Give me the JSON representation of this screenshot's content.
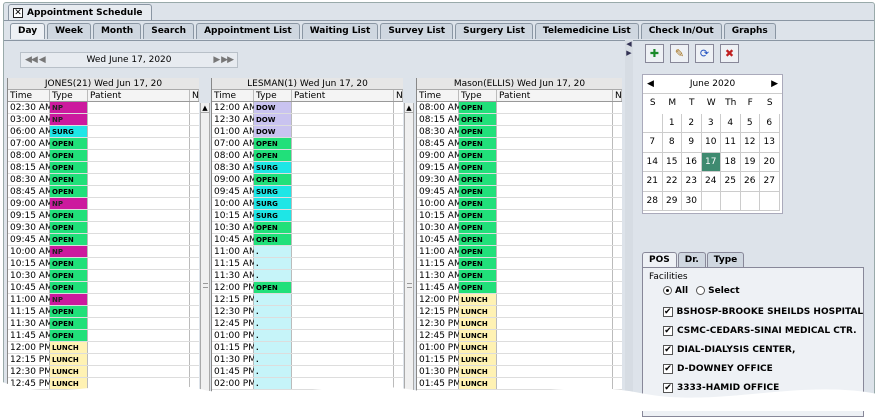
{
  "window": {
    "title": "Appointment Schedule"
  },
  "tabs": [
    "Day",
    "Week",
    "Month",
    "Search",
    "Appointment List",
    "Waiting List",
    "Survey List",
    "Surgery List",
    "Telemedicine List",
    "Check In/Out",
    "Graphs"
  ],
  "active_tab": "Day",
  "datebar": {
    "prev": "◀◀ ◀",
    "date": "Wed   June 17, 2020",
    "next": "▶ ▶▶"
  },
  "table_headers": {
    "time": "Time",
    "type": "Type",
    "patient": "Patient",
    "note": "N"
  },
  "columns": [
    {
      "header": "JONES(21) Wed Jun 17, 20",
      "rows": [
        [
          "02:30 AM",
          "NP"
        ],
        [
          "03:00 AM",
          "NP"
        ],
        [
          "06:00 AM",
          "SURG"
        ],
        [
          "07:00 AM",
          "OPEN"
        ],
        [
          "08:00 AM",
          "OPEN"
        ],
        [
          "08:15 AM",
          "OPEN"
        ],
        [
          "08:30 AM",
          "OPEN"
        ],
        [
          "08:45 AM",
          "OPEN"
        ],
        [
          "09:00 AM",
          "NP"
        ],
        [
          "09:15 AM",
          "OPEN"
        ],
        [
          "09:30 AM",
          "OPEN"
        ],
        [
          "09:45 AM",
          "OPEN"
        ],
        [
          "10:00 AM",
          "NP"
        ],
        [
          "10:15 AM",
          "OPEN"
        ],
        [
          "10:30 AM",
          "OPEN"
        ],
        [
          "10:45 AM",
          "OPEN"
        ],
        [
          "11:00 AM",
          "NP"
        ],
        [
          "11:15 AM",
          "OPEN"
        ],
        [
          "11:30 AM",
          "OPEN"
        ],
        [
          "11:45 AM",
          "OPEN"
        ],
        [
          "12:00 PM",
          "LUNCH"
        ],
        [
          "12:15 PM",
          "LUNCH"
        ],
        [
          "12:30 PM",
          "LUNCH"
        ],
        [
          "12:45 PM",
          "LUNCH"
        ]
      ]
    },
    {
      "header": "LESMAN(1) Wed Jun 17, 20",
      "rows": [
        [
          "12:00 AM",
          "DOW"
        ],
        [
          "12:30 AM",
          "DOW"
        ],
        [
          "01:00 AM",
          "DOW"
        ],
        [
          "07:00 AM",
          "OPEN"
        ],
        [
          "08:00 AM",
          "OPEN"
        ],
        [
          "08:30 AM",
          "SURG"
        ],
        [
          "09:00 AM",
          "OPEN"
        ],
        [
          "09:45 AM",
          "SURG"
        ],
        [
          "10:00 AM",
          "SURG"
        ],
        [
          "10:15 AM",
          "SURG"
        ],
        [
          "10:30 AM",
          "OPEN"
        ],
        [
          "10:45 AM",
          "OPEN"
        ],
        [
          "11:00 AM",
          "."
        ],
        [
          "11:15 AM",
          "."
        ],
        [
          "11:30 AM",
          "."
        ],
        [
          "12:00 PM",
          "OPEN"
        ],
        [
          "12:15 PM",
          "."
        ],
        [
          "12:30 PM",
          "."
        ],
        [
          "12:45 PM",
          "."
        ],
        [
          "01:00 PM",
          "."
        ],
        [
          "01:15 PM",
          "."
        ],
        [
          "01:30 PM",
          "."
        ],
        [
          "01:45 PM",
          "."
        ],
        [
          "02:00 PM",
          "."
        ]
      ]
    },
    {
      "header": "Mason(ELLIS) Wed Jun 17, 20",
      "rows": [
        [
          "08:00 AM",
          "OPEN"
        ],
        [
          "08:15 AM",
          "OPEN"
        ],
        [
          "08:30 AM",
          "OPEN"
        ],
        [
          "08:45 AM",
          "OPEN"
        ],
        [
          "09:00 AM",
          "OPEN"
        ],
        [
          "09:15 AM",
          "OPEN"
        ],
        [
          "09:30 AM",
          "OPEN"
        ],
        [
          "09:45 AM",
          "OPEN"
        ],
        [
          "10:00 AM",
          "OPEN"
        ],
        [
          "10:15 AM",
          "OPEN"
        ],
        [
          "10:30 AM",
          "OPEN"
        ],
        [
          "10:45 AM",
          "OPEN"
        ],
        [
          "11:00 AM",
          "OPEN"
        ],
        [
          "11:15 AM",
          "OPEN"
        ],
        [
          "11:30 AM",
          "OPEN"
        ],
        [
          "11:45 AM",
          "OPEN"
        ],
        [
          "12:00 PM",
          "LUNCH"
        ],
        [
          "12:15 PM",
          "LUNCH"
        ],
        [
          "12:30 PM",
          "LUNCH"
        ],
        [
          "12:45 PM",
          "LUNCH"
        ],
        [
          "01:00 PM",
          "LUNCH"
        ],
        [
          "01:15 PM",
          "LUNCH"
        ],
        [
          "01:30 PM",
          "LUNCH"
        ],
        [
          "01:45 PM",
          "LUNCH"
        ]
      ]
    }
  ],
  "type_colors": {
    "NP": "#cc1a9e",
    "SURG": "#1ee6e6",
    "OPEN": "#21e07a",
    "LUNCH": "#fff2b3",
    "DOW": "#c9c3f0",
    ".": "#c6f4f9"
  },
  "toolbar_icons": [
    "add-appointment-icon",
    "edit-appointment-icon",
    "refresh-icon",
    "delete-appointment-icon"
  ],
  "calendar": {
    "month_label": "June  2020",
    "weekdays": [
      "S",
      "M",
      "T",
      "W",
      "Th",
      "F",
      "S"
    ],
    "weeks": [
      [
        "",
        "1",
        "2",
        "3",
        "4",
        "5",
        "6"
      ],
      [
        "7",
        "8",
        "9",
        "10",
        "11",
        "12",
        "13"
      ],
      [
        "14",
        "15",
        "16",
        "17",
        "18",
        "19",
        "20"
      ],
      [
        "21",
        "22",
        "23",
        "24",
        "25",
        "26",
        "27"
      ],
      [
        "28",
        "29",
        "30",
        "",
        "",
        "",
        ""
      ]
    ],
    "selected": "17"
  },
  "filter": {
    "tabs": [
      "POS",
      "Dr.",
      "Type"
    ],
    "active_tab": "POS",
    "label": "Facilities",
    "radio_all": "All",
    "radio_select": "Select",
    "selected_radio": "All",
    "facilities": [
      "BSHOSP-BROOKE SHEILDS HOSPITAL",
      "CSMC-CEDARS-SINAI MEDICAL CTR.",
      "DIAL-DIALYSIS CENTER,",
      "D-DOWNEY OFFICE",
      "3333-HAMID OFFICE"
    ]
  }
}
